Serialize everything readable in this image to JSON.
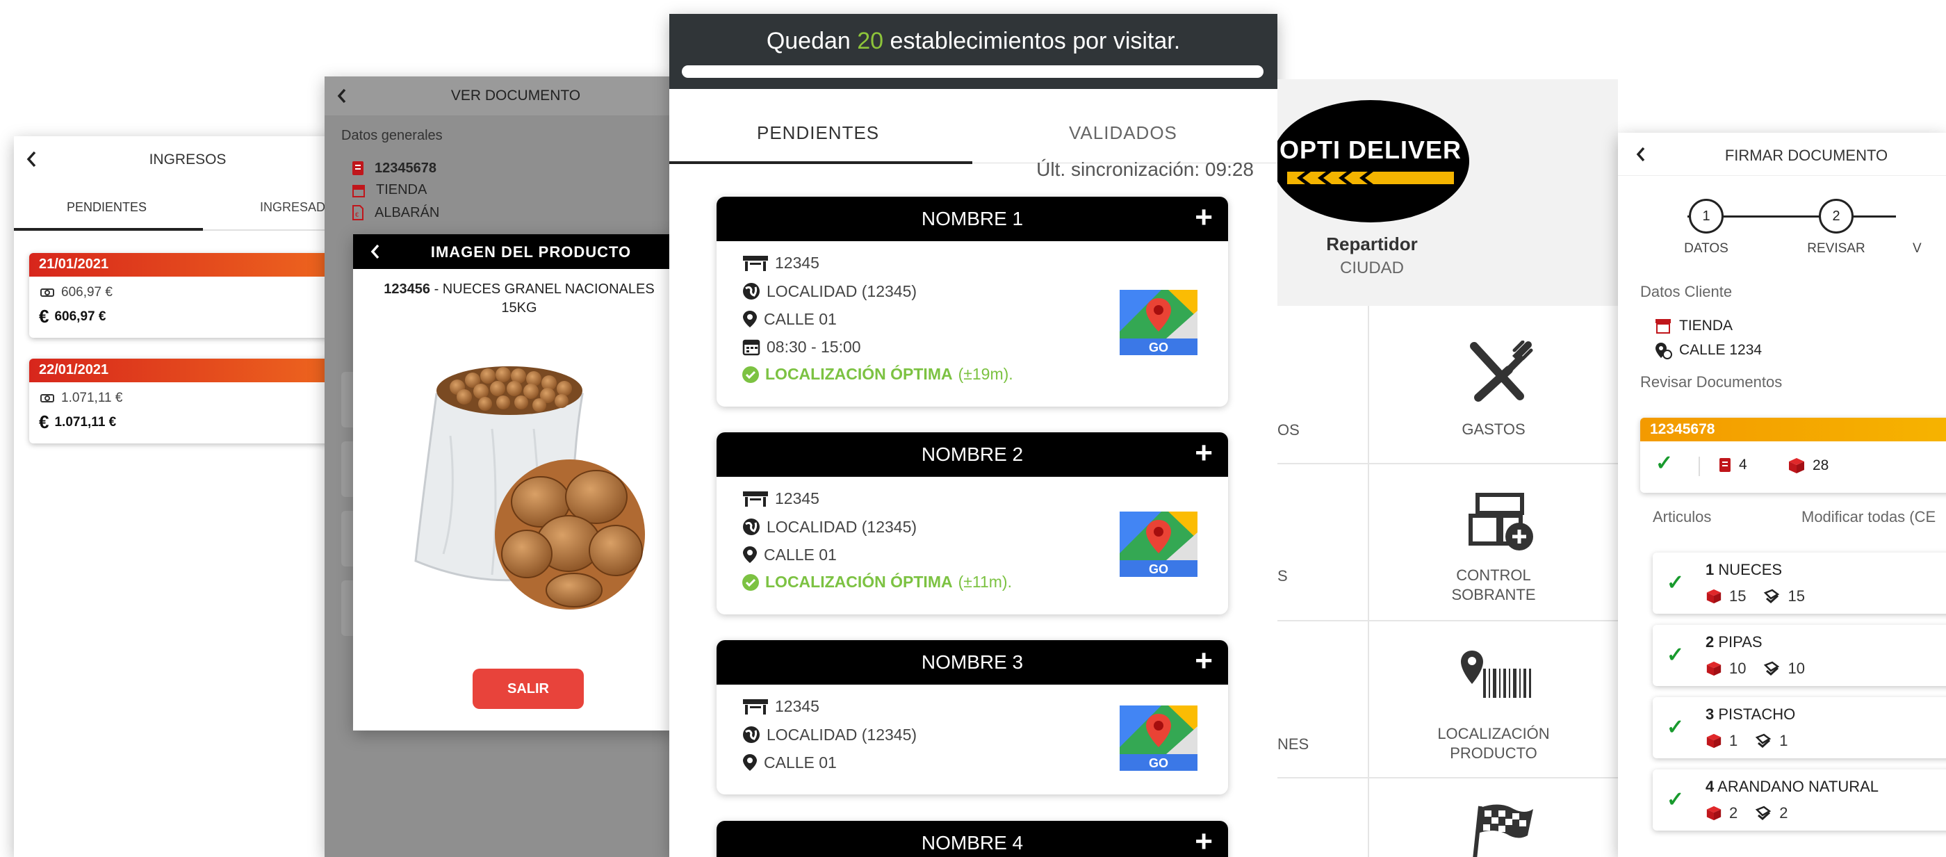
{
  "ingresos": {
    "title": "INGRESOS",
    "tabs": [
      "PENDIENTES",
      "INGRESADOS"
    ],
    "entries": [
      {
        "date": "21/01/2021",
        "amount": "606,97 €",
        "total": "606,97 €"
      },
      {
        "date": "22/01/2021",
        "amount": "1.071,11 €",
        "total": "1.071,11 €"
      }
    ]
  },
  "ver_documento": {
    "title": "VER DOCUMENTO",
    "section": "Datos generales",
    "doc_number": "12345678",
    "store": "TIENDA",
    "doc_type": "ALBARÁN",
    "modal": {
      "title": "IMAGEN DEL PRODUCTO",
      "product_code": "123456",
      "product_name": " - NUECES GRANEL NACIONALES",
      "product_weight": "15KG",
      "close_label": "SALIR"
    }
  },
  "main": {
    "remaining_prefix": "Quedan ",
    "remaining_count": "20",
    "remaining_suffix": " establecimientos por visitar.",
    "progress": 0.0,
    "tabs": [
      "PENDIENTES",
      "VALIDADOS"
    ],
    "sync_label": "Últ. sincronización: 09:28",
    "stores": [
      {
        "name": "NOMBRE 1",
        "code": "12345",
        "locality": "LOCALIDAD (12345)",
        "street": "CALLE 01",
        "hours": "08:30 - 15:00",
        "location_status": "LOCALIZACIÓN ÓPTIMA",
        "location_tolerance": "(±19m)."
      },
      {
        "name": "NOMBRE 2",
        "code": "12345",
        "locality": "LOCALIDAD (12345)",
        "street": "CALLE 01",
        "location_status": "LOCALIZACIÓN ÓPTIMA",
        "location_tolerance": "(±11m)."
      },
      {
        "name": "NOMBRE 3",
        "code": "12345",
        "locality": "LOCALIDAD (12345)",
        "street": "CALLE 01"
      },
      {
        "name": "NOMBRE 4"
      }
    ],
    "map_badge": "GO",
    "plus": "+"
  },
  "menu": {
    "logo_text": "OPTI DELIVER",
    "role": "Repartidor",
    "city": "CIUDAD",
    "partial_labels": [
      "OS",
      "S",
      "NES"
    ],
    "items": [
      {
        "label": "GASTOS",
        "icon": "cutlery-icon"
      },
      {
        "label_line1": "CONTROL",
        "label_line2": "SOBRANTE",
        "icon": "boxes-add-icon"
      },
      {
        "label_line1": "LOCALIZACIÓN",
        "label_line2": "PRODUCTO",
        "icon": "location-barcode-icon"
      },
      {
        "icon": "checkered-flag-icon"
      }
    ]
  },
  "firmar": {
    "title": "FIRMAR DOCUMENTO",
    "steps": [
      {
        "n": "1",
        "label": "DATOS"
      },
      {
        "n": "2",
        "label": "REVISAR"
      },
      {
        "label": "V"
      }
    ],
    "client_section": "Datos Cliente",
    "store": "TIENDA",
    "street": "CALLE 1234",
    "review_section": "Revisar Documentos",
    "doc_number": "12345678",
    "doc_count": "4",
    "box_count": "28",
    "articles_label": "Articulos",
    "modify_all": "Modificar todas (CE",
    "articles": [
      {
        "n": "1",
        "name": "NUECES",
        "qty": "15",
        "checked": "15"
      },
      {
        "n": "2",
        "name": "PIPAS",
        "qty": "10",
        "checked": "10"
      },
      {
        "n": "3",
        "name": "PISTACHO",
        "qty": "1",
        "checked": "1"
      },
      {
        "n": "4",
        "name": "ARANDANO NATURAL",
        "qty": "2",
        "checked": "2"
      }
    ]
  },
  "colors": {
    "accent_green": "#8dc43a",
    "ok_green": "#7cc242",
    "red": "#e8433b",
    "orange_gradient_start": "#d7261c",
    "orange_gradient_end": "#ef6a1e",
    "dark_bar": "#303538"
  }
}
